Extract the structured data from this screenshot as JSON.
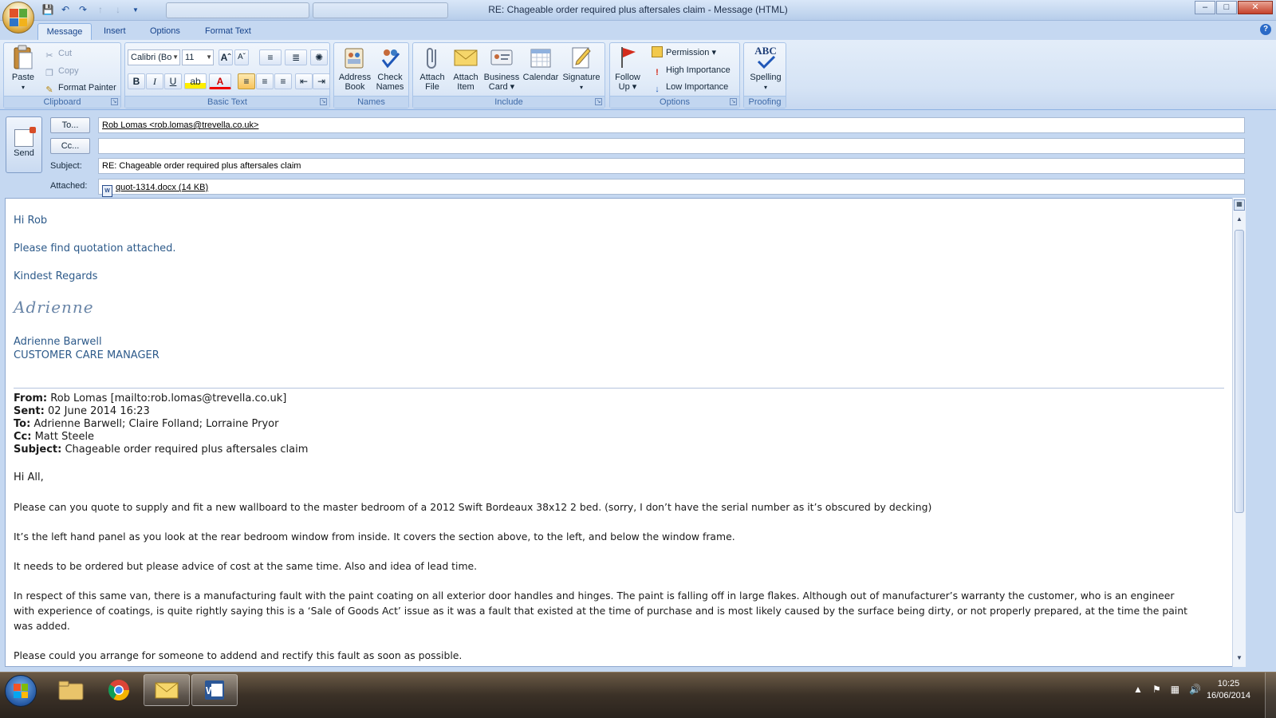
{
  "window": {
    "title": "RE: Chageable order required plus aftersales claim - Message (HTML)",
    "controls": [
      "–",
      "□",
      "✕"
    ]
  },
  "tabs": [
    "Message",
    "Insert",
    "Options",
    "Format Text"
  ],
  "ribbon": {
    "clipboard": {
      "label": "Clipboard",
      "paste": "Paste",
      "cut": "Cut",
      "copy": "Copy",
      "format_painter": "Format Painter"
    },
    "basic_text": {
      "label": "Basic Text",
      "font": "Calibri (Bo",
      "size": "11",
      "bold": "B",
      "italic": "I",
      "underline": "U"
    },
    "names": {
      "label": "Names",
      "address_book_1": "Address",
      "address_book_2": "Book",
      "check_names_1": "Check",
      "check_names_2": "Names"
    },
    "include": {
      "label": "Include",
      "attach_file_1": "Attach",
      "attach_file_2": "File",
      "attach_item_1": "Attach",
      "attach_item_2": "Item",
      "business_card_1": "Business",
      "business_card_2": "Card ▾",
      "calendar": "Calendar",
      "signature": "Signature"
    },
    "options": {
      "label": "Options",
      "follow_up_1": "Follow",
      "follow_up_2": "Up ▾",
      "permission": "Permission ▾",
      "high_importance": "High Importance",
      "low_importance": "Low Importance"
    },
    "proofing": {
      "label": "Proofing",
      "spelling": "Spelling",
      "abc": "ABC"
    }
  },
  "header": {
    "send": "Send",
    "to_button": "To...",
    "cc_button": "Cc...",
    "subject_label": "Subject:",
    "attached_label": "Attached:",
    "to_value": "Rob Lomas <rob.lomas@trevella.co.uk>",
    "cc_value": "",
    "subject_value": "RE: Chageable order required plus aftersales claim",
    "attachment": "quot-1314.docx (14 KB)"
  },
  "body": {
    "greeting": "Hi Rob",
    "line1": "Please find quotation attached.",
    "regards": "Kindest Regards",
    "signature_script": "Adrienne",
    "sig_name": "Adrienne Barwell",
    "sig_title": "CUSTOMER CARE MANAGER",
    "from_label": "From:",
    "from_value": " Rob Lomas [mailto:rob.lomas@trevella.co.uk]",
    "sent_label": "Sent:",
    "sent_value": " 02 June 2014 16:23",
    "to_label": "To:",
    "to_value": " Adrienne Barwell; Claire Folland; Lorraine Pryor",
    "cc_label": "Cc:",
    "cc_value": " Matt Steele",
    "subject_label": "Subject:",
    "subject_value": " Chageable order required plus aftersales claim",
    "hi_all": "Hi All,",
    "p1": "Please can you quote to supply and fit a new wallboard to the master bedroom of a 2012 Swift Bordeaux 38x12 2 bed. (sorry, I don’t have the serial number as it’s obscured by decking)",
    "p2": "It’s the left hand panel as you look at the rear bedroom window from inside. It covers the section above, to the left, and below the window frame.",
    "p3": "It needs to be ordered but please advice of cost at the same time. Also and idea of lead time.",
    "p4a": "In respect of this same van, there is a manufacturing fault with the paint coating on all exterior door handles and hinges. The paint is falling off in large flakes. Although out of manufacturer’s warranty the customer, who is an engineer",
    "p4b": "with experience of coatings, is quite rightly saying this is a ‘Sale of Goods Act’ issue as it was a fault that existed at the time of purchase and is most likely caused by the surface being dirty, or not properly prepared, at the time the paint",
    "p4c": "was added.",
    "p5": "Please could you arrange for someone to addend and rectify this fault as soon as possible."
  },
  "taskbar": {
    "time": "10:25",
    "date": "16/06/2014"
  },
  "colors": {
    "accent": "#15428b",
    "signature_blue": "#2d5a8a",
    "ribbon_bg": "#d5e3f5"
  }
}
